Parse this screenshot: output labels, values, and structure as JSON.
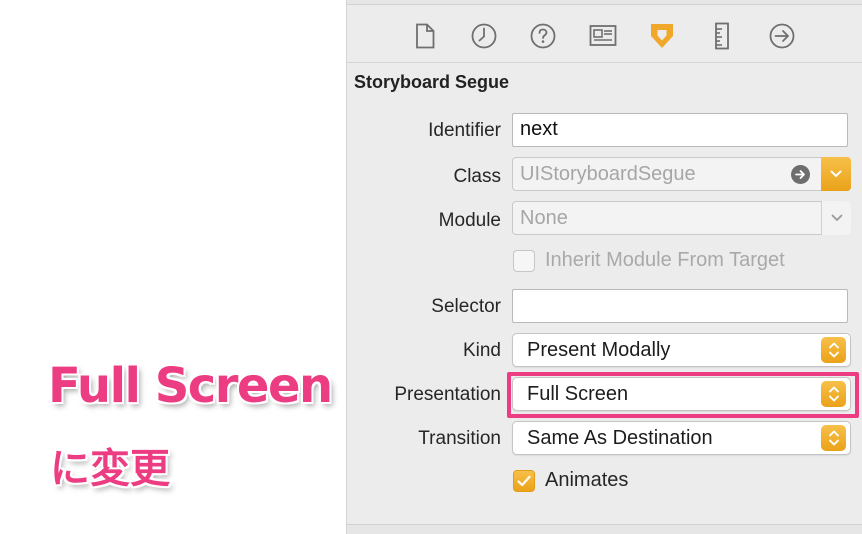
{
  "annotation": {
    "line1": "Full Screen",
    "line2": "に変更",
    "color": "#ec3c82"
  },
  "tabs": [
    {
      "icon": "file-icon",
      "name": "File Inspector"
    },
    {
      "icon": "clock-icon",
      "name": "History Inspector"
    },
    {
      "icon": "help-icon",
      "name": "Quick Help Inspector"
    },
    {
      "icon": "identity-icon",
      "name": "Identity Inspector"
    },
    {
      "icon": "attributes-icon",
      "name": "Attributes Inspector",
      "active": true
    },
    {
      "icon": "ruler-icon",
      "name": "Size Inspector"
    },
    {
      "icon": "connections-icon",
      "name": "Connections Inspector"
    }
  ],
  "section_title": "Storyboard Segue",
  "fields": {
    "identifier": {
      "label": "Identifier",
      "value": "next"
    },
    "class": {
      "label": "Class",
      "value": "UIStoryboardSegue"
    },
    "module": {
      "label": "Module",
      "value": "None"
    },
    "inherit": {
      "label": "Inherit Module From Target",
      "checked": false
    },
    "selector": {
      "label": "Selector",
      "value": ""
    },
    "kind": {
      "label": "Kind",
      "value": "Present Modally"
    },
    "presentation": {
      "label": "Presentation",
      "value": "Full Screen"
    },
    "transition": {
      "label": "Transition",
      "value": "Same As Destination"
    },
    "animates": {
      "label": "Animates",
      "checked": true
    }
  },
  "colors": {
    "accent": "#f0a82a",
    "panel_bg": "#ececec",
    "highlight": "#ec3c82"
  }
}
